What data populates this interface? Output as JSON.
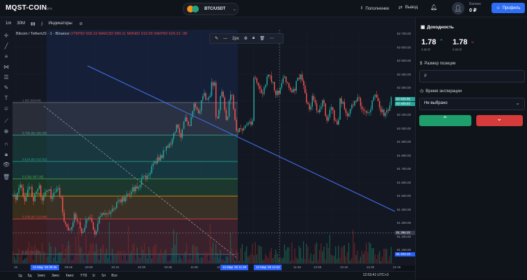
{
  "header": {
    "logo": "MQST-COIN",
    "logo_suffix": "pro",
    "pair": "BTC/USDT",
    "deposit_label": "Пополнение",
    "withdraw_label": "Вывод",
    "balance_label": "Баланс",
    "balance_value": "0 ₽",
    "profile_label": "Профиль"
  },
  "chart_toolbar": {
    "interval_1": "1m",
    "interval_2": "30М",
    "indicators_label": "Индикаторы"
  },
  "legend": {
    "symbol": "Bitcoin / TetherUS · 1 · Binance",
    "open": "ОТКР82 668.19",
    "high": "МАКС82 689.11",
    "low": "МИН82 610.99",
    "close": "ЗАКР82 629.23",
    "change": "-38"
  },
  "drawing_toolbar": {
    "width_label": "2px"
  },
  "fib_levels": [
    {
      "label": "1 (82 928.84)",
      "color": "#787b86"
    },
    {
      "label": "0.786 (82 291.05)",
      "color": "#4caf9a"
    },
    {
      "label": "0.618 (82 015.82)",
      "color": "#26a69a"
    },
    {
      "label": "0.5 (81 867.36)",
      "color": "#4caf50"
    },
    {
      "label": "0.382 (81 739.31)",
      "color": "#ff9800"
    },
    {
      "label": "0.236 (81 513.88)",
      "color": "#e04848"
    },
    {
      "label": "0 (81 203.19)",
      "color": "#787b86"
    }
  ],
  "price_axis": {
    "labels": [
      "82 700.00",
      "82 600.00",
      "82 500.00",
      "82 400.00",
      "82 300.00",
      "82 200.00",
      "82 100.00",
      "82 000.00",
      "81 900.00",
      "81 800.00",
      "81 700.00",
      "81 600.00",
      "81 500.00",
      "81 400.00",
      "81 300.00",
      "81 200.00",
      "81 100.00"
    ],
    "current_price_tag": "82 525.90",
    "current_price_tag2": "82 508.84",
    "crosshair_tag": "81 398.20",
    "fib_low_tag": "81 203.19"
  },
  "time_axis": {
    "labels": [
      "15",
      "09:45",
      "10:00",
      "10:15",
      "10:30",
      "10:45",
      "11:00",
      "11:15",
      "11:45",
      "12:00",
      "12:15",
      "12:30",
      "12:45",
      "13:00"
    ],
    "tag_left": "12 Мар '25  09:36",
    "tag_mid1": "12 Мар '25  11:20",
    "tag_mid2": "12 Мар '25  11:53"
  },
  "bottom_bar": {
    "ranges": [
      "1д",
      "5д",
      "1мес",
      "3мес",
      "6мес",
      "YTD",
      "1г",
      "5л",
      "Все"
    ],
    "clock": "12:53:41 UTC+3"
  },
  "right_panel": {
    "profit_title": "Доходность",
    "up_value": "1.78",
    "up_sub": "0.00 ₽",
    "down_value": "1.78",
    "down_sub": "0.00 ₽",
    "position_size_label": "Размер позиции",
    "position_size_placeholder": "₽",
    "expiry_label": "Время экспирации",
    "expiry_value": "Не выбрано",
    "up_icon": "chevron-up-icon",
    "down_icon": "chevron-down-icon"
  },
  "colors": {
    "accent": "#2e6ef2",
    "up": "#1e9e6b",
    "down": "#d63b3b",
    "trendline": "#3f6fe8"
  }
}
